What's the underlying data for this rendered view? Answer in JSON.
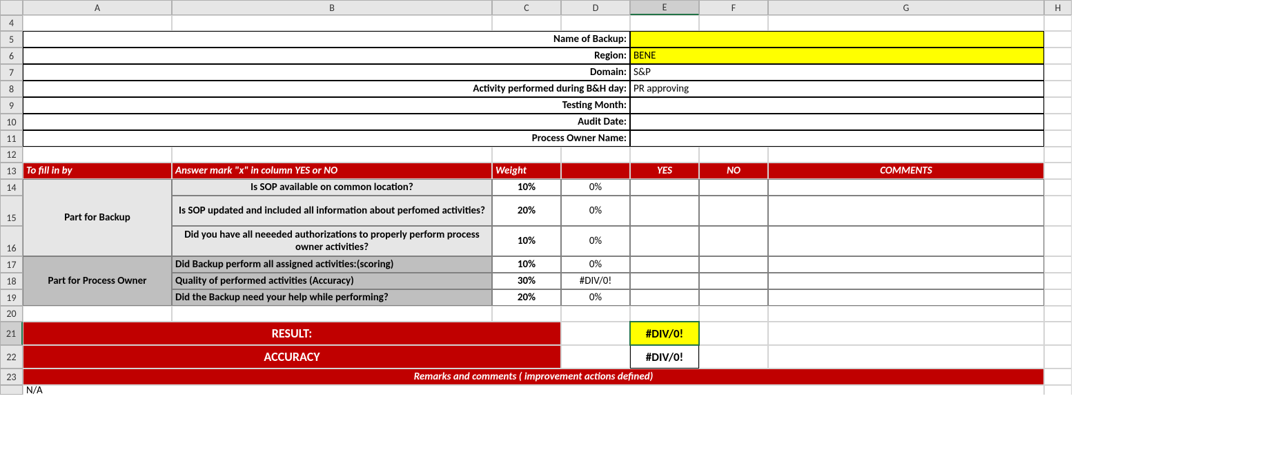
{
  "columns": [
    "A",
    "B",
    "C",
    "D",
    "E",
    "F",
    "G",
    "H"
  ],
  "rows": [
    "4",
    "5",
    "6",
    "7",
    "8",
    "9",
    "10",
    "11",
    "12",
    "13",
    "14",
    "15",
    "16",
    "17",
    "18",
    "19",
    "20",
    "21",
    "22",
    "23",
    ""
  ],
  "meta": {
    "name_of_backup_lbl": "Name of Backup:",
    "name_of_backup_val": "",
    "region_lbl": "Region:",
    "region_val": "BENE",
    "domain_lbl": "Domain:",
    "domain_val": "S&P",
    "activity_lbl": "Activity performed during B&H day:",
    "activity_val": "PR approving",
    "testing_month_lbl": "Testing Month:",
    "testing_month_val": "",
    "audit_date_lbl": "Audit Date:",
    "audit_date_val": "",
    "owner_lbl": "Process Owner Name:",
    "owner_val": ""
  },
  "hdr": {
    "tofill": "To fill in by",
    "answer": "Answer mark \"x\" in column YES or NO",
    "weight": "Weight",
    "yes": "YES",
    "no": "NO",
    "comments": "COMMENTS"
  },
  "sections": {
    "backup": "Part for Backup",
    "owner": "Part for Process Owner"
  },
  "q": {
    "r14": {
      "text": "Is SOP available on common location?",
      "w": "10%",
      "d": "0%"
    },
    "r15": {
      "text": "Is SOP updated and included all information about perfomed activities?",
      "w": "20%",
      "d": "0%"
    },
    "r16": {
      "text": "Did you have all neeeded authorizations to properly perform process owner activities?",
      "w": "10%",
      "d": "0%"
    },
    "r17": {
      "text": "Did Backup perform all assigned activities:(scoring)",
      "w": "10%",
      "d": "0%"
    },
    "r18": {
      "text": "Quality of performed activities (Accuracy)",
      "w": "30%",
      "d": "#DIV/0!"
    },
    "r19": {
      "text": "Did the Backup need your help while performing?",
      "w": "20%",
      "d": "0%"
    }
  },
  "result": {
    "result_lbl": "RESULT:",
    "accuracy_lbl": "ACCURACY",
    "result_val": "#DIV/0!",
    "accuracy_val": "#DIV/0!"
  },
  "remarks_hdr": "Remarks and comments ( improvement actions defined)",
  "remarks_val": "N/A"
}
